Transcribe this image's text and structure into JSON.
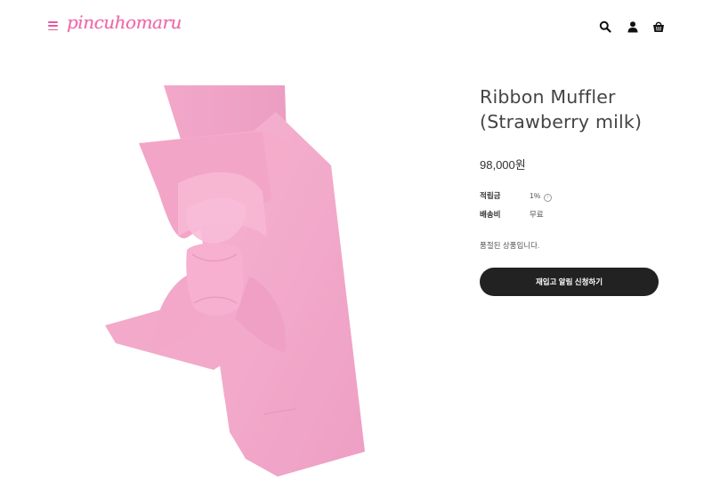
{
  "header": {
    "logo_text": "pincuhomaru",
    "brand_color": "#ef6aa9",
    "icons": [
      "menu-icon",
      "search-icon",
      "account-icon",
      "shopping-bag-icon"
    ]
  },
  "product": {
    "title_line1": "Ribbon Muffler",
    "title_line2": "(Strawberry milk)",
    "price": "98,000원",
    "details": [
      {
        "label": "적립금",
        "value": "1%"
      },
      {
        "label": "배송비",
        "value": "무료"
      }
    ],
    "info_icon": "i",
    "soldout_text": "품절된 상품입니다.",
    "restock_button_label": "재입고 알림 신청하기",
    "image_color": "#f4a6c8"
  }
}
